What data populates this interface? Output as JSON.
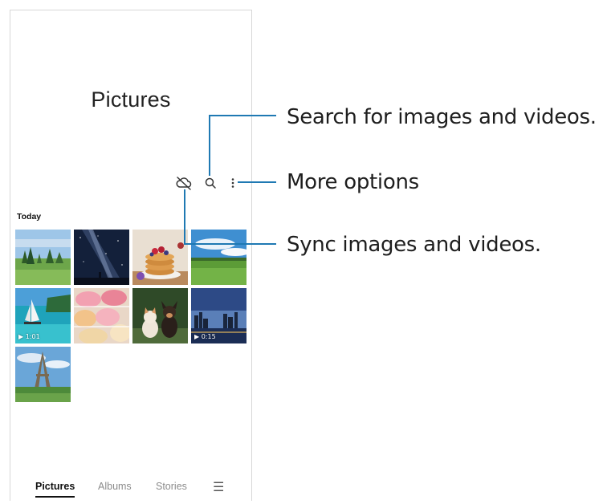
{
  "app": {
    "title": "Pictures"
  },
  "toolbar": {
    "sync_icon": "cloud-off-icon",
    "search_icon": "search-icon",
    "more_icon": "more-vertical-icon"
  },
  "gallery": {
    "section_label": "Today",
    "items": [
      {
        "subject": "landscape-trees",
        "duration": ""
      },
      {
        "subject": "night-sky-milky-way",
        "duration": ""
      },
      {
        "subject": "pancakes-berries",
        "duration": ""
      },
      {
        "subject": "green-field-sky",
        "duration": ""
      },
      {
        "subject": "sailboat-sea",
        "duration": "1:01"
      },
      {
        "subject": "macarons",
        "duration": ""
      },
      {
        "subject": "cat-and-dog",
        "duration": ""
      },
      {
        "subject": "city-skyline-dusk",
        "duration": "0:15"
      },
      {
        "subject": "eiffel-tower",
        "duration": ""
      }
    ]
  },
  "bottom_nav": {
    "tabs": [
      {
        "label": "Pictures",
        "active": true
      },
      {
        "label": "Albums",
        "active": false
      },
      {
        "label": "Stories",
        "active": false
      }
    ],
    "menu_icon": "hamburger-menu-icon"
  },
  "callouts": {
    "search": "Search for images and videos.",
    "more": "More options",
    "sync": "Sync images and videos."
  },
  "colors": {
    "leader": "#1f79b3",
    "active_tab": "#111111",
    "inactive_tab": "#8b8b8b"
  }
}
